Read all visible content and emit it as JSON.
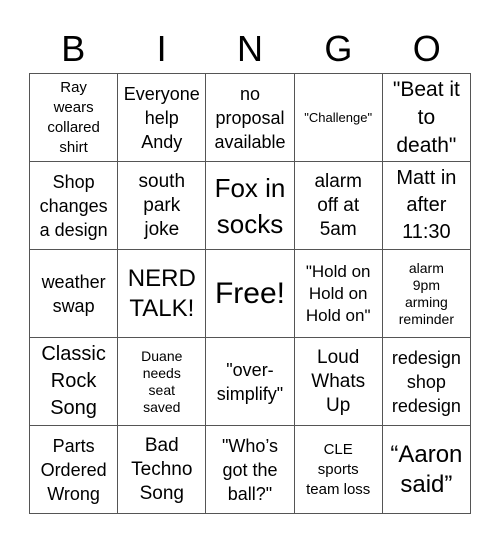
{
  "header": {
    "letters": [
      "B",
      "I",
      "N",
      "G",
      "O"
    ]
  },
  "board": {
    "rows": [
      [
        {
          "text": "Ray\nwears\ncollared\nshirt",
          "free": false
        },
        {
          "text": "Everyone\nhelp\nAndy",
          "free": false
        },
        {
          "text": "no\nproposal\navailable",
          "free": false
        },
        {
          "text": "\"Challenge\"",
          "free": false
        },
        {
          "text": "\"Beat it\nto\ndeath\"",
          "free": false
        }
      ],
      [
        {
          "text": "Shop\nchanges\na design",
          "free": false
        },
        {
          "text": "south\npark\njoke",
          "free": false
        },
        {
          "text": "Fox in\nsocks",
          "free": false
        },
        {
          "text": "alarm\noff at\n5am",
          "free": false
        },
        {
          "text": "Matt in\nafter\n11:30",
          "free": false
        }
      ],
      [
        {
          "text": "weather\nswap",
          "free": false
        },
        {
          "text": "NERD\nTALK!",
          "free": false
        },
        {
          "text": "Free!",
          "free": true
        },
        {
          "text": "\"Hold on\nHold on\nHold on\"",
          "free": false
        },
        {
          "text": "alarm\n9pm\narming\nreminder",
          "free": false
        }
      ],
      [
        {
          "text": "Classic\nRock\nSong",
          "free": false
        },
        {
          "text": "Duane\nneeds\nseat\nsaved",
          "free": false
        },
        {
          "text": "\"over-\nsimplify\"",
          "free": false
        },
        {
          "text": "Loud\nWhats\nUp",
          "free": false
        },
        {
          "text": "redesign\nshop\nredesign",
          "free": false
        }
      ],
      [
        {
          "text": "Parts\nOrdered\nWrong",
          "free": false
        },
        {
          "text": "Bad\nTechno\nSong",
          "free": false
        },
        {
          "text": "\"Who’s\ngot the\nball?\"",
          "free": false
        },
        {
          "text": "CLE\nsports\nteam loss",
          "free": false
        },
        {
          "text": "“Aaron\nsaid”",
          "free": false
        }
      ]
    ]
  },
  "colors": {
    "grid_line": "#555555",
    "text": "#000000",
    "background": "#ffffff"
  }
}
